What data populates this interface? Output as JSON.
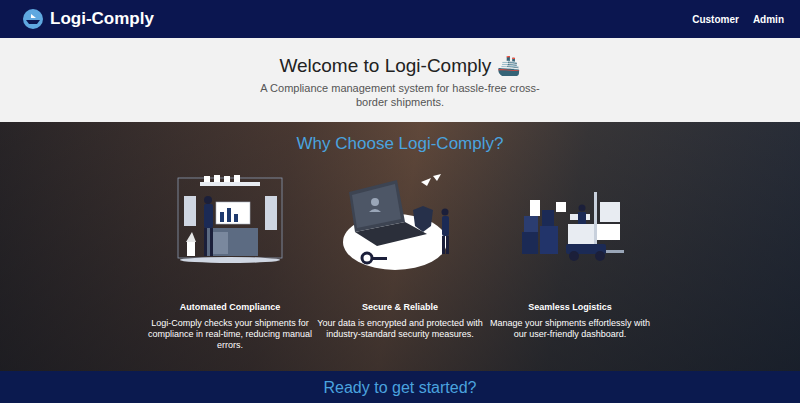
{
  "nav": {
    "brand": "Logi-Comply",
    "links": [
      {
        "label": "Customer"
      },
      {
        "label": "Admin"
      }
    ]
  },
  "hero": {
    "title": "Welcome to Logi-Comply",
    "emoji": "🚢",
    "subtitle": "A Compliance management system for hassle-free cross-border shipments."
  },
  "features": {
    "heading": "Why Choose Logi-Comply?",
    "cards": [
      {
        "kind": "compliance",
        "title": "Automated Compliance",
        "text": "Logi-Comply checks your shipments for compliance in real-time, reducing manual errors."
      },
      {
        "kind": "security",
        "title": "Secure & Reliable",
        "text": "Your data is encrypted and protected with industry-standard security measures."
      },
      {
        "kind": "logistics",
        "title": "Seamless Logistics",
        "text": "Manage your shipments effortlessly with our user-friendly dashboard."
      }
    ]
  },
  "cta": {
    "heading": "Ready to get started?"
  }
}
